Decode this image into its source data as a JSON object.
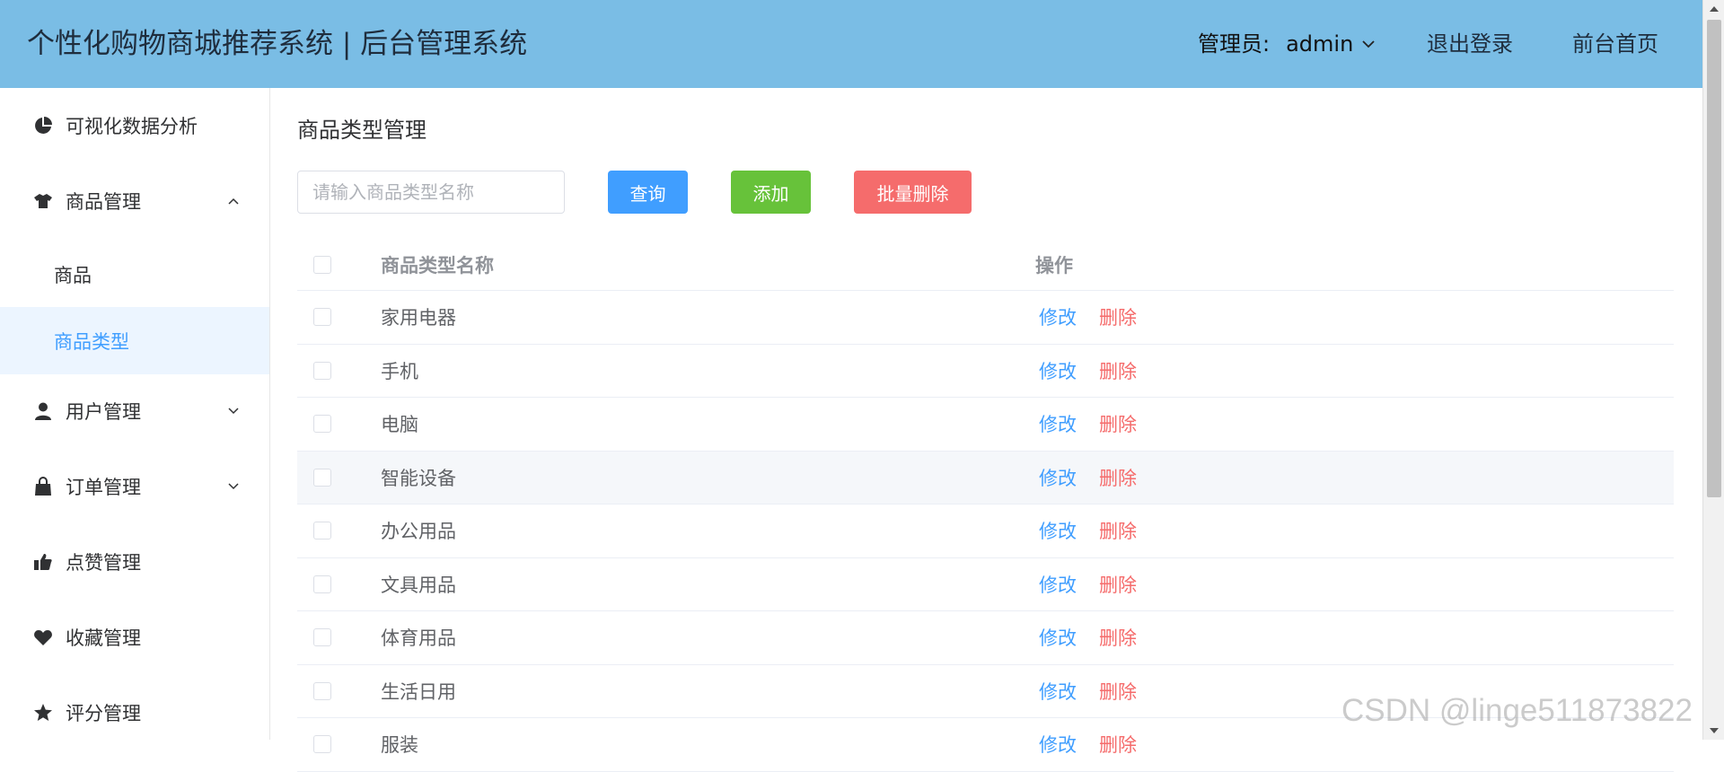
{
  "header": {
    "title": "个性化购物商城推荐系统 | 后台管理系统",
    "admin_label": "管理员:",
    "admin_name": "admin",
    "logout": "退出登录",
    "home": "前台首页",
    "bg_color": "#7abde5"
  },
  "sidebar": {
    "items": [
      {
        "label": "可视化数据分析",
        "icon": "pie-chart-icon",
        "expandable": false
      },
      {
        "label": "商品管理",
        "icon": "shirt-icon",
        "expandable": true,
        "expanded": true
      },
      {
        "label": "用户管理",
        "icon": "user-icon",
        "expandable": true,
        "expanded": false
      },
      {
        "label": "订单管理",
        "icon": "shopping-bag-icon",
        "expandable": true,
        "expanded": false
      },
      {
        "label": "点赞管理",
        "icon": "thumbs-up-icon",
        "expandable": false
      },
      {
        "label": "收藏管理",
        "icon": "heart-icon",
        "expandable": false
      },
      {
        "label": "评分管理",
        "icon": "star-icon",
        "expandable": false
      }
    ],
    "submenu": [
      {
        "label": "商品",
        "active": false
      },
      {
        "label": "商品类型",
        "active": true
      }
    ]
  },
  "main": {
    "page_title": "商品类型管理",
    "search": {
      "placeholder": "请输入商品类型名称",
      "value": ""
    },
    "buttons": {
      "query": "查询",
      "add": "添加",
      "batch_delete": "批量删除"
    },
    "table": {
      "columns": [
        "商品类型名称",
        "操作"
      ],
      "edit_label": "修改",
      "delete_label": "删除",
      "rows": [
        {
          "name": "家用电器"
        },
        {
          "name": "手机"
        },
        {
          "name": "电脑"
        },
        {
          "name": "智能设备"
        },
        {
          "name": "办公用品"
        },
        {
          "name": "文具用品"
        },
        {
          "name": "体育用品"
        },
        {
          "name": "生活日用"
        },
        {
          "name": "服装"
        }
      ]
    }
  },
  "watermark": "CSDN @linge511873822",
  "colors": {
    "primary": "#409eff",
    "success": "#67c23a",
    "danger": "#f56c6c",
    "active_bg": "#ecf5ff"
  }
}
